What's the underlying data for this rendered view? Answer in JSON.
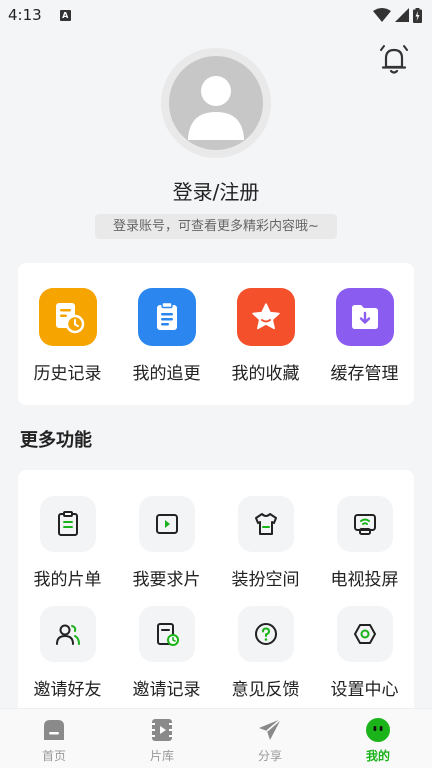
{
  "status": {
    "time": "4:13",
    "badge": "A"
  },
  "profile": {
    "login_title": "登录/注册",
    "login_subtitle": "登录账号，可查看更多精彩内容哦~"
  },
  "quick_actions": [
    {
      "label": "历史记录",
      "icon": "history-icon",
      "color": "#f6a400"
    },
    {
      "label": "我的追更",
      "icon": "follow-update-icon",
      "color": "#2b86f0"
    },
    {
      "label": "我的收藏",
      "icon": "star-icon",
      "color": "#f4502c"
    },
    {
      "label": "缓存管理",
      "icon": "download-folder-icon",
      "color": "#8b5cf0"
    }
  ],
  "more": {
    "title": "更多功能",
    "items": [
      {
        "label": "我的片单",
        "icon": "playlist-icon"
      },
      {
        "label": "我要求片",
        "icon": "request-video-icon"
      },
      {
        "label": "装扮空间",
        "icon": "shirt-icon"
      },
      {
        "label": "电视投屏",
        "icon": "tv-cast-icon"
      },
      {
        "label": "邀请好友",
        "icon": "invite-friends-icon"
      },
      {
        "label": "邀请记录",
        "icon": "invite-record-icon"
      },
      {
        "label": "意见反馈",
        "icon": "feedback-icon"
      },
      {
        "label": "设置中心",
        "icon": "settings-icon"
      }
    ]
  },
  "tabs": [
    {
      "label": "首页",
      "icon": "home-icon"
    },
    {
      "label": "片库",
      "icon": "library-icon"
    },
    {
      "label": "分享",
      "icon": "share-icon"
    },
    {
      "label": "我的",
      "icon": "profile-icon",
      "active": true
    }
  ],
  "colors": {
    "accent": "#1bb31a",
    "background": "#f4f5f7"
  }
}
